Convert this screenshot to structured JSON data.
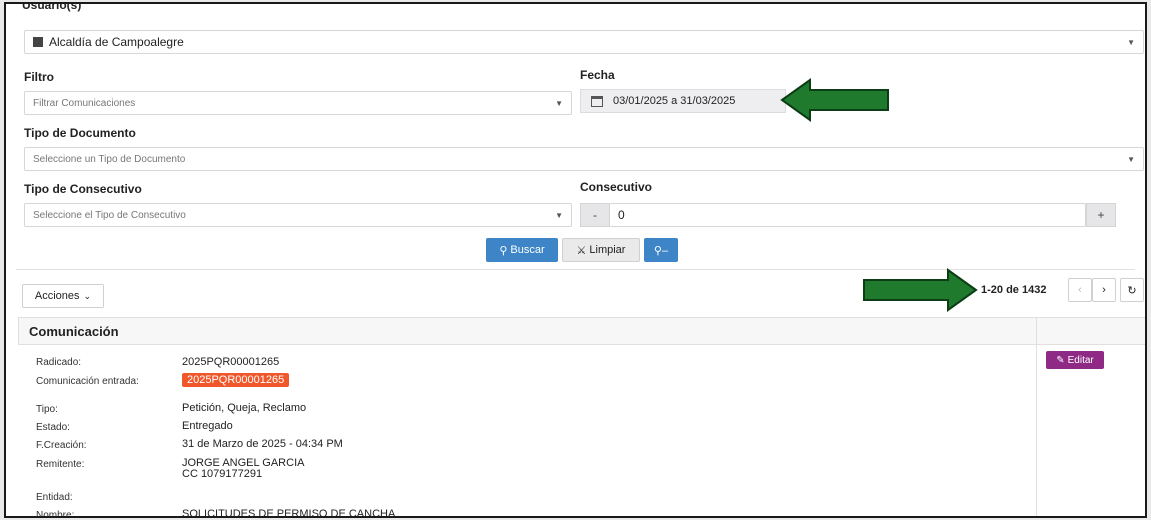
{
  "usuario": {
    "label": "Usuario(s)",
    "value": "Alcaldía de Campoalegre"
  },
  "filtro": {
    "label": "Filtro",
    "placeholder": "Filtrar Comunicaciones"
  },
  "fecha": {
    "label": "Fecha",
    "value": "03/01/2025 a 31/03/2025"
  },
  "tipo_documento": {
    "label": "Tipo de Documento",
    "placeholder": "Seleccione un Tipo de Documento"
  },
  "tipo_consecutivo": {
    "label": "Tipo de Consecutivo",
    "placeholder": "Seleccione el Tipo de Consecutivo"
  },
  "consecutivo": {
    "label": "Consecutivo",
    "value": "0",
    "minus": "-",
    "plus": "+"
  },
  "buttons": {
    "buscar": "Buscar",
    "limpiar": "Limpiar"
  },
  "acciones": {
    "label": "Acciones"
  },
  "pagination": {
    "range": "1-20 de 1432"
  },
  "card": {
    "title": "Comunicación",
    "edit_label": "Editar",
    "rows": [
      {
        "key": "Radicado:",
        "value": "2025PQR00001265"
      },
      {
        "key": "Comunicación entrada:",
        "value": "2025PQR00001265"
      },
      {
        "key": "Tipo:",
        "value": "Petición, Queja, Reclamo"
      },
      {
        "key": "Estado:",
        "value": "Entregado"
      },
      {
        "key": "F.Creación:",
        "value": "31 de Marzo de 2025 - 04:34 PM"
      },
      {
        "key": "Remitente:",
        "value": "JORGE ANGEL GARCIA"
      },
      {
        "key": "",
        "value": "CC 1079177291"
      },
      {
        "key": "Entidad:",
        "value": ""
      },
      {
        "key": "Nombre:",
        "value": "SOLICITUDES DE PERMISO DE CANCHA"
      }
    ]
  },
  "colors": {
    "primary": "#3d85c6",
    "badge": "#f0582b",
    "edit": "#8e2a86",
    "arrow": "#1f7a2e"
  }
}
